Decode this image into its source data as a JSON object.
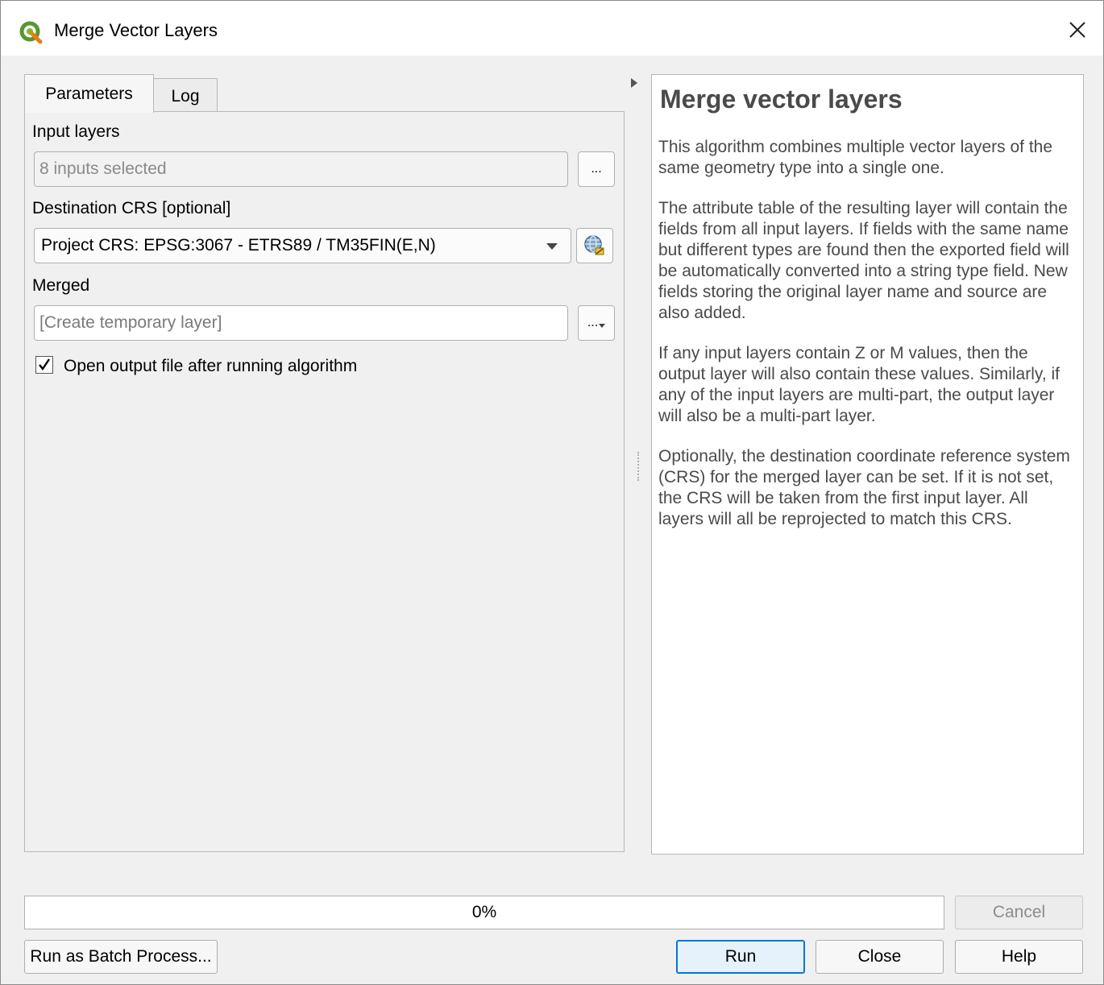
{
  "window": {
    "title": "Merge Vector Layers",
    "app_icon": "qgis-logo-icon",
    "close_icon": "close-icon"
  },
  "tabs": [
    {
      "label": "Parameters",
      "active": true
    },
    {
      "label": "Log",
      "active": false
    }
  ],
  "parameters": {
    "input_layers": {
      "label": "Input layers",
      "value": "8 inputs selected",
      "button_label": "..."
    },
    "destination_crs": {
      "label": "Destination CRS [optional]",
      "value": "Project CRS: EPSG:3067 - ETRS89 / TM35FIN(E,N)",
      "button_icon": "crs-globe-icon"
    },
    "merged": {
      "label": "Merged",
      "placeholder": "[Create temporary layer]",
      "button_label": "..."
    },
    "open_output": {
      "label": "Open output file after running algorithm",
      "checked": true
    }
  },
  "help": {
    "title": "Merge vector layers",
    "paragraphs": [
      "This algorithm combines multiple vector layers of the same geometry type into a single one.",
      "The attribute table of the resulting layer will contain the fields from all input layers. If fields with the same name but different types are found then the exported field will be automatically converted into a string type field. New fields storing the original layer name and source are also added.",
      "If any input layers contain Z or M values, then the output layer will also contain these values. Similarly, if any of the input layers are multi-part, the output layer will also be a multi-part layer.",
      "Optionally, the destination coordinate reference system (CRS) for the merged layer can be set. If it is not set, the CRS will be taken from the first input layer. All layers will all be reprojected to match this CRS."
    ]
  },
  "progress": {
    "value": 0,
    "text": "0%"
  },
  "buttons": {
    "cancel": "Cancel",
    "batch": "Run as Batch Process...",
    "run": "Run",
    "close": "Close",
    "help": "Help"
  }
}
